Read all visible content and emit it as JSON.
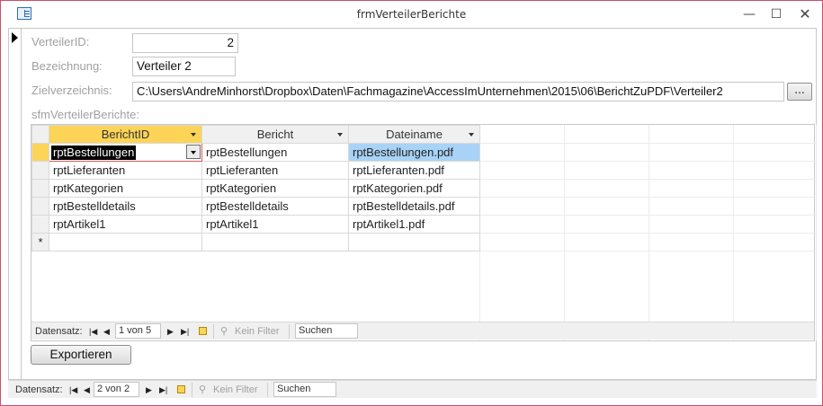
{
  "window": {
    "title": "frmVerteilerBerichte",
    "minimize": "—",
    "maximize": "☐",
    "close": "✕"
  },
  "form": {
    "verteiler_id_label": "VerteilerID:",
    "verteiler_id_value": "2",
    "bezeichnung_label": "Bezeichnung:",
    "bezeichnung_value": "Verteiler 2",
    "zielverzeichnis_label": "Zielverzeichnis:",
    "zielverzeichnis_value": "C:\\Users\\AndreMinhorst\\Dropbox\\Daten\\Fachmagazine\\AccessImUnternehmen\\2015\\06\\BerichtZuPDF\\Verteiler2",
    "browse_button": "...",
    "subform_label": "sfmVerteilerBerichte:",
    "export_button": "Exportieren"
  },
  "grid": {
    "columns": [
      "BerichtID",
      "Bericht",
      "Dateiname"
    ],
    "rows": [
      [
        "rptBestellungen",
        "rptBestellungen",
        "rptBestellungen.pdf"
      ],
      [
        "rptLieferanten",
        "rptLieferanten",
        "rptLieferanten.pdf"
      ],
      [
        "rptKategorien",
        "rptKategorien",
        "rptKategorien.pdf"
      ],
      [
        "rptBestelldetails",
        "rptBestelldetails",
        "rptBestelldetails.pdf"
      ],
      [
        "rptArtikel1",
        "rptArtikel1",
        "rptArtikel1.pdf"
      ]
    ],
    "new_row_marker": "*"
  },
  "subform_nav": {
    "label": "Datensatz:",
    "position": "1 von 5",
    "filter": "Kein Filter",
    "search_placeholder": "Suchen"
  },
  "form_nav": {
    "label": "Datensatz:",
    "position": "2 von 2",
    "filter": "Kein Filter",
    "search_placeholder": "Suchen"
  },
  "nav_glyphs": {
    "first": "|◀",
    "prev": "◀",
    "next": "▶",
    "last": "▶|",
    "filter_icon": "⚲"
  },
  "colors": {
    "active_header": "#fbd458",
    "selected_cell": "#a8d3f7",
    "window_border": "#c94f6d"
  }
}
